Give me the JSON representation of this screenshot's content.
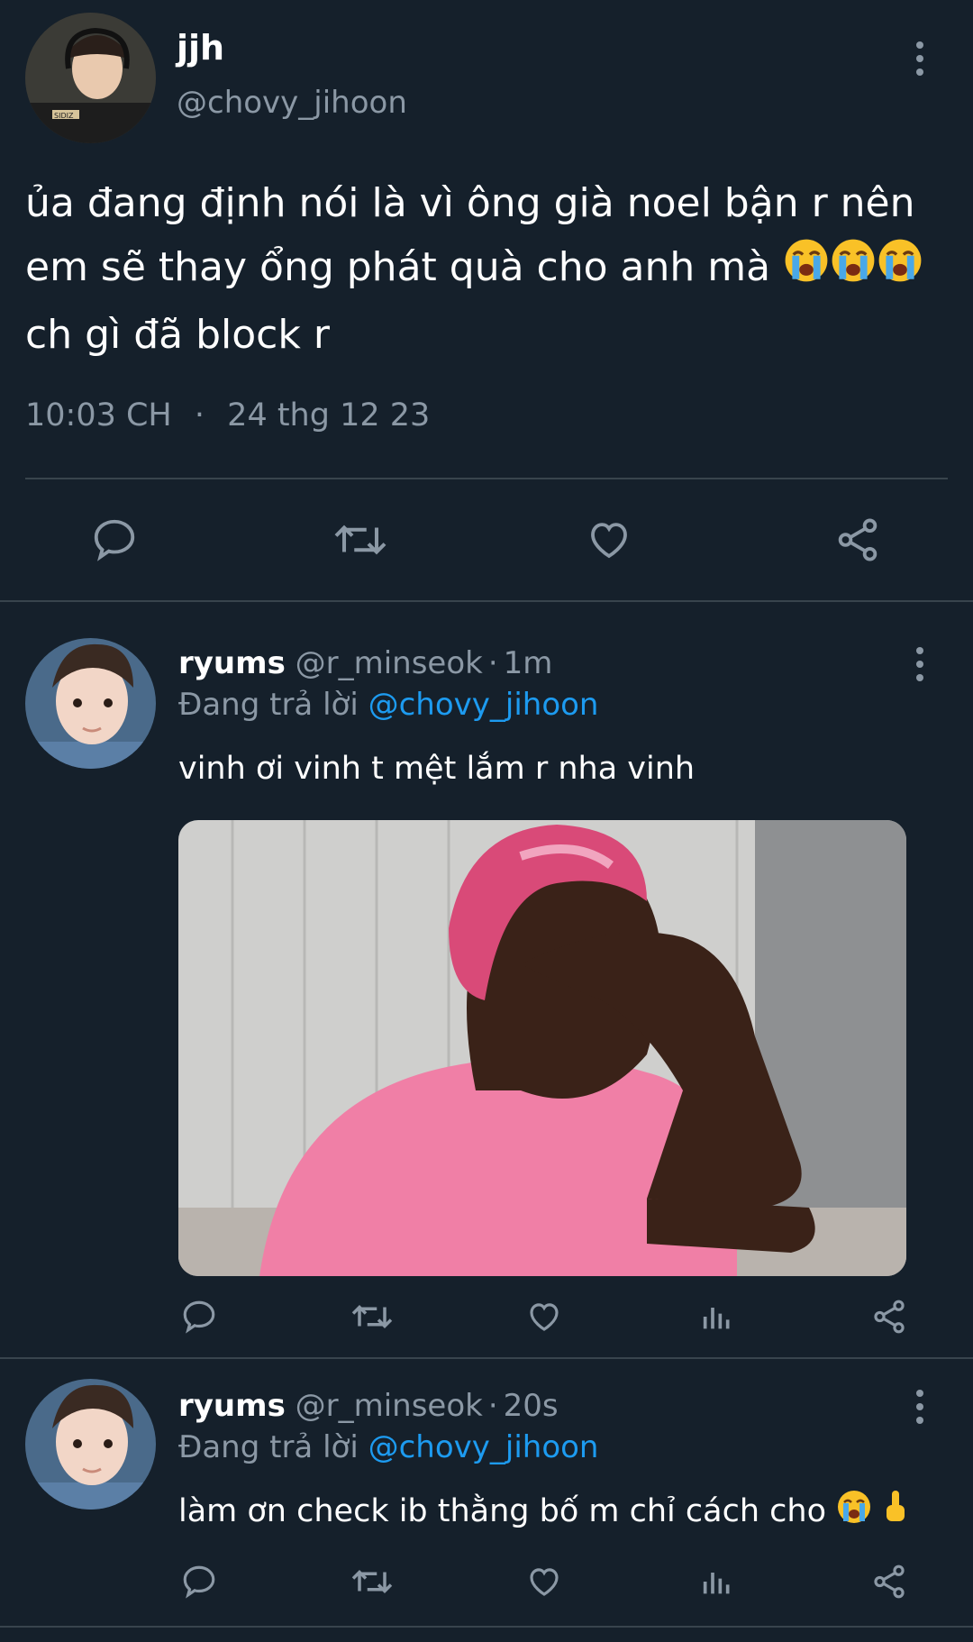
{
  "main_tweet": {
    "display_name": "jjh",
    "handle": "@chovy_jihoon",
    "text_before_emoji": "ủa đang định nói là vì ông già noel bận r nên em sẽ thay ổng phát quà cho anh mà",
    "emojis": [
      "loudly-crying-face",
      "loudly-crying-face",
      "loudly-crying-face"
    ],
    "text_after_emoji": "ch gì đã block r",
    "time": "10:03 CH",
    "separator": "·",
    "date": "24 thg 12 23",
    "actions": [
      "reply-icon",
      "retweet-icon",
      "like-icon",
      "share-icon"
    ]
  },
  "replies": [
    {
      "display_name": "ryums",
      "handle": "@r_minseok",
      "dot": "·",
      "time": "1m",
      "replying_label": "Đang trả lời",
      "replying_to": "@chovy_jihoon",
      "text": "vinh ơi vinh t mệt lắm r nha vinh",
      "media": "photo-woman-in-pink-hand-on-forehead",
      "actions": [
        "reply-icon",
        "retweet-icon",
        "like-icon",
        "views-icon",
        "share-icon"
      ]
    },
    {
      "display_name": "ryums",
      "handle": "@r_minseok",
      "dot": "·",
      "time": "20s",
      "replying_label": "Đang trả lời",
      "replying_to": "@chovy_jihoon",
      "text": "làm ơn check ib thằng bố m chỉ cách cho",
      "emojis": [
        "loudly-crying-face",
        "backhand-index-pointing-up"
      ],
      "actions": [
        "reply-icon",
        "retweet-icon",
        "like-icon",
        "views-icon",
        "share-icon"
      ]
    }
  ],
  "colors": {
    "background": "#15202b",
    "text": "#ffffff",
    "muted": "#8b98a5",
    "link": "#1d9bf0",
    "divider": "#38444d"
  }
}
